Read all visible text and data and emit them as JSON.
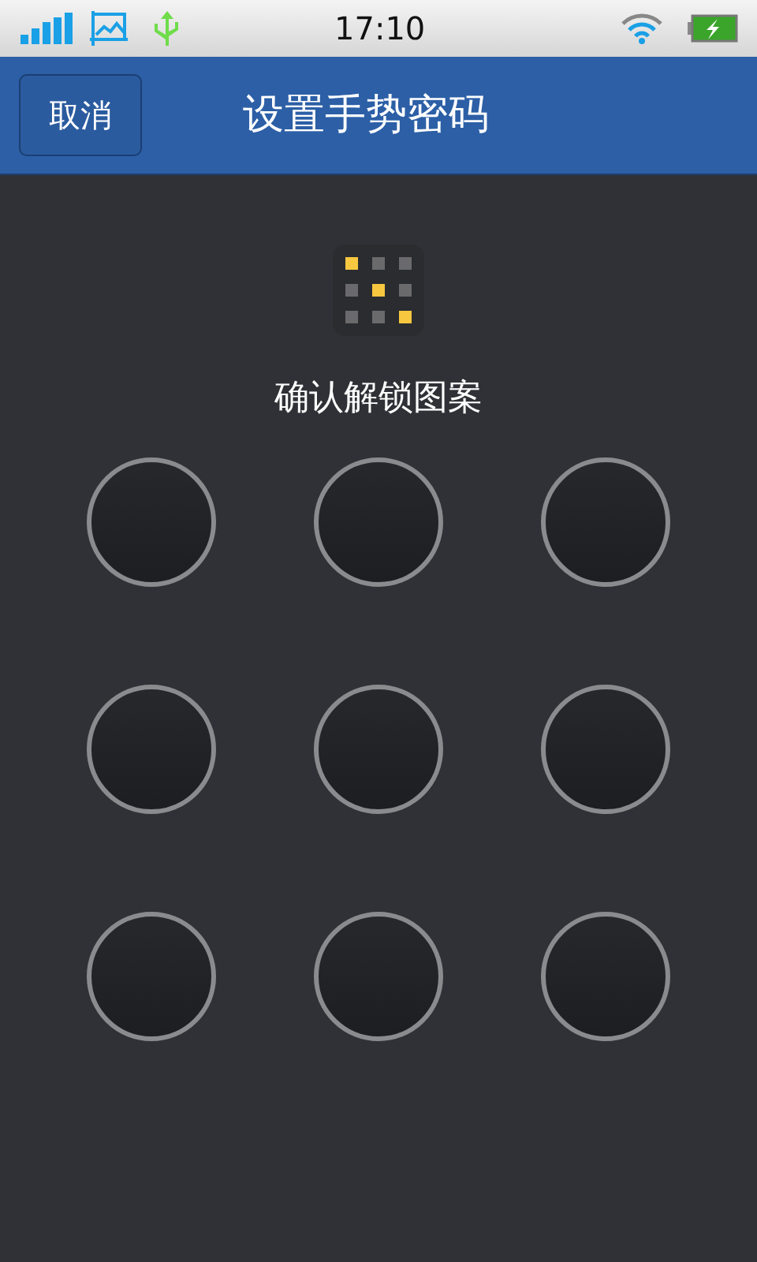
{
  "status_bar": {
    "time": "17:10"
  },
  "header": {
    "cancel_button": "取消",
    "title": "设置手势密码"
  },
  "preview": [
    {
      "selected": true
    },
    {
      "selected": false
    },
    {
      "selected": false
    },
    {
      "selected": false
    },
    {
      "selected": true
    },
    {
      "selected": false
    },
    {
      "selected": false
    },
    {
      "selected": false
    },
    {
      "selected": true
    }
  ],
  "prompt": "确认解锁图案",
  "nodes": [
    {
      "selected": false
    },
    {
      "selected": false
    },
    {
      "selected": false
    },
    {
      "selected": false
    },
    {
      "selected": false
    },
    {
      "selected": false
    },
    {
      "selected": false
    },
    {
      "selected": false
    },
    {
      "selected": false
    }
  ]
}
